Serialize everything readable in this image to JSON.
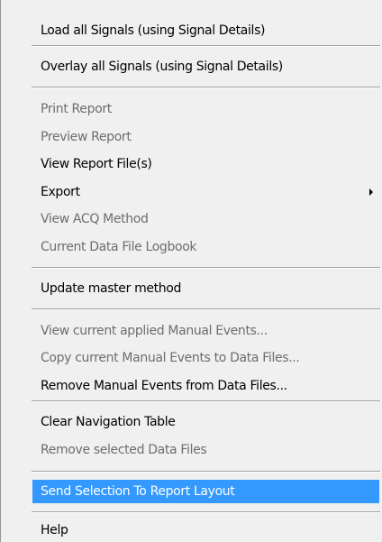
{
  "menu": {
    "items": [
      {
        "label": "Load all Signals (using Signal Details)",
        "enabled": true
      },
      {
        "label": "Overlay all Signals (using Signal Details)",
        "enabled": true
      },
      {
        "label": "Print Report",
        "enabled": false
      },
      {
        "label": "Preview Report",
        "enabled": false
      },
      {
        "label": "View Report File(s)",
        "enabled": true
      },
      {
        "label": "Export",
        "enabled": true,
        "submenu": true
      },
      {
        "label": "View ACQ Method",
        "enabled": false
      },
      {
        "label": "Current Data File Logbook",
        "enabled": false
      },
      {
        "label": "Update master method",
        "enabled": true
      },
      {
        "label": "View current applied Manual Events...",
        "enabled": false
      },
      {
        "label": "Copy current Manual Events to Data Files...",
        "enabled": false
      },
      {
        "label": "Remove Manual Events from Data Files...",
        "enabled": true
      },
      {
        "label": "Clear Navigation Table",
        "enabled": true
      },
      {
        "label": "Remove selected Data Files",
        "enabled": false
      },
      {
        "label": "Send Selection To Report Layout",
        "enabled": true,
        "highlighted": true
      },
      {
        "label": "Help",
        "enabled": true
      }
    ],
    "colors": {
      "background": "#f0f0f0",
      "text": "#000000",
      "disabled_text": "#6d6d6d",
      "highlight": "#3399ff",
      "highlight_text": "#ffffff"
    }
  }
}
